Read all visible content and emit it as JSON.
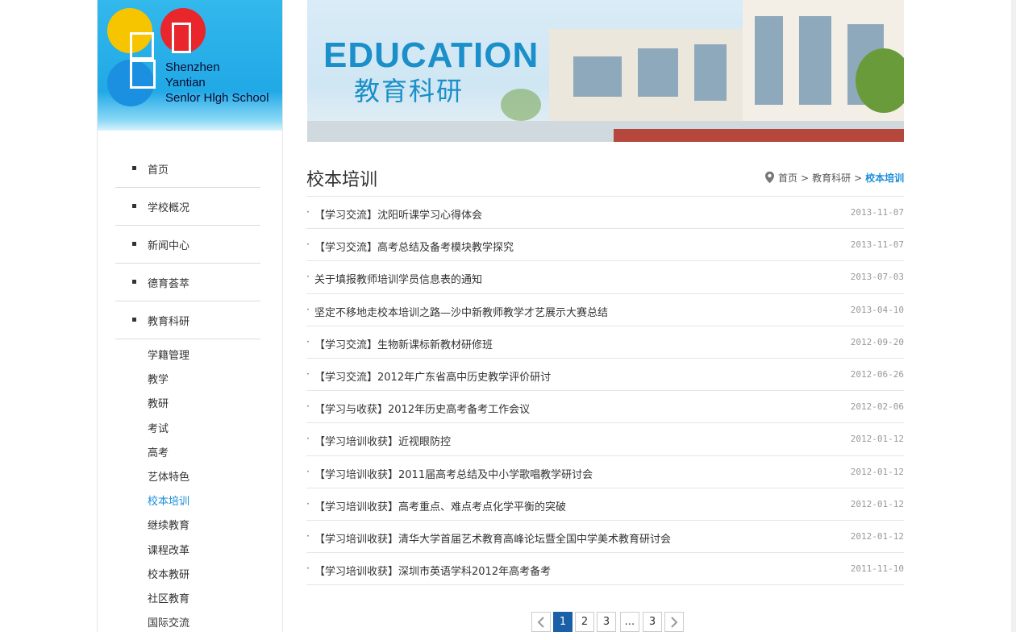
{
  "logo": {
    "lines": [
      "Shenzhen",
      "Yantian",
      "Senlor Hlgh School"
    ]
  },
  "banner": {
    "en_title": "EDUCATION",
    "cn_title": "教育科研"
  },
  "nav": {
    "items": [
      {
        "label": "首页"
      },
      {
        "label": "学校概况"
      },
      {
        "label": "新闻中心"
      },
      {
        "label": "德育荟萃"
      },
      {
        "label": "教育科研"
      }
    ],
    "sub_items": [
      {
        "label": "学籍管理"
      },
      {
        "label": "教学"
      },
      {
        "label": "教研"
      },
      {
        "label": "考试"
      },
      {
        "label": "高考"
      },
      {
        "label": "艺体特色"
      },
      {
        "label": "校本培训",
        "active": true
      },
      {
        "label": "继续教育"
      },
      {
        "label": "课程改革"
      },
      {
        "label": "校本教研"
      },
      {
        "label": "社区教育"
      },
      {
        "label": "国际交流"
      }
    ]
  },
  "page": {
    "title": "校本培训",
    "breadcrumb": {
      "home": "首页",
      "sep": ">",
      "section": "教育科研",
      "current": "校本培训"
    }
  },
  "articles": [
    {
      "bullet": "·",
      "title": "【学习交流】沈阳听课学习心得体会",
      "date": "2013-11-07"
    },
    {
      "bullet": "·",
      "title": "【学习交流】高考总结及备考模块教学探究",
      "date": "2013-11-07"
    },
    {
      "bullet": "·",
      "title": "关于填报教师培训学员信息表的通知",
      "date": "2013-07-03"
    },
    {
      "bullet": "·",
      "title": "坚定不移地走校本培训之路—沙中新教师教学才艺展示大赛总结",
      "date": "2013-04-10"
    },
    {
      "bullet": "·",
      "title": "【学习交流】生物新课标新教材研修班",
      "date": "2012-09-20"
    },
    {
      "bullet": "·",
      "title": "【学习交流】2012年广东省高中历史教学评价研讨",
      "date": "2012-06-26"
    },
    {
      "bullet": "·",
      "title": "【学习与收获】2012年历史高考备考工作会议",
      "date": "2012-02-06"
    },
    {
      "bullet": "·",
      "title": "【学习培训收获】近视眼防控",
      "date": "2012-01-12"
    },
    {
      "bullet": "·",
      "title": "【学习培训收获】2011届高考总结及中小学歌唱教学研讨会",
      "date": "2012-01-12"
    },
    {
      "bullet": "·",
      "title": "【学习培训收获】高考重点、难点考点化学平衡的突破",
      "date": "2012-01-12"
    },
    {
      "bullet": "·",
      "title": "【学习培训收获】清华大学首届艺术教育高峰论坛暨全国中学美术教育研讨会",
      "date": "2012-01-12"
    },
    {
      "bullet": "·",
      "title": "【学习培训收获】深圳市英语学科2012年高考备考",
      "date": "2011-11-10"
    }
  ],
  "pagination": {
    "pages": [
      "1",
      "2",
      "3",
      "...",
      "3"
    ],
    "current": "1",
    "prev_icon": "chevron-left-icon",
    "next_icon": "chevron-right-icon"
  },
  "colors": {
    "accent": "#1a8ed8",
    "pager_active": "#1a5fa8",
    "banner_text": "#1a8fc9"
  }
}
